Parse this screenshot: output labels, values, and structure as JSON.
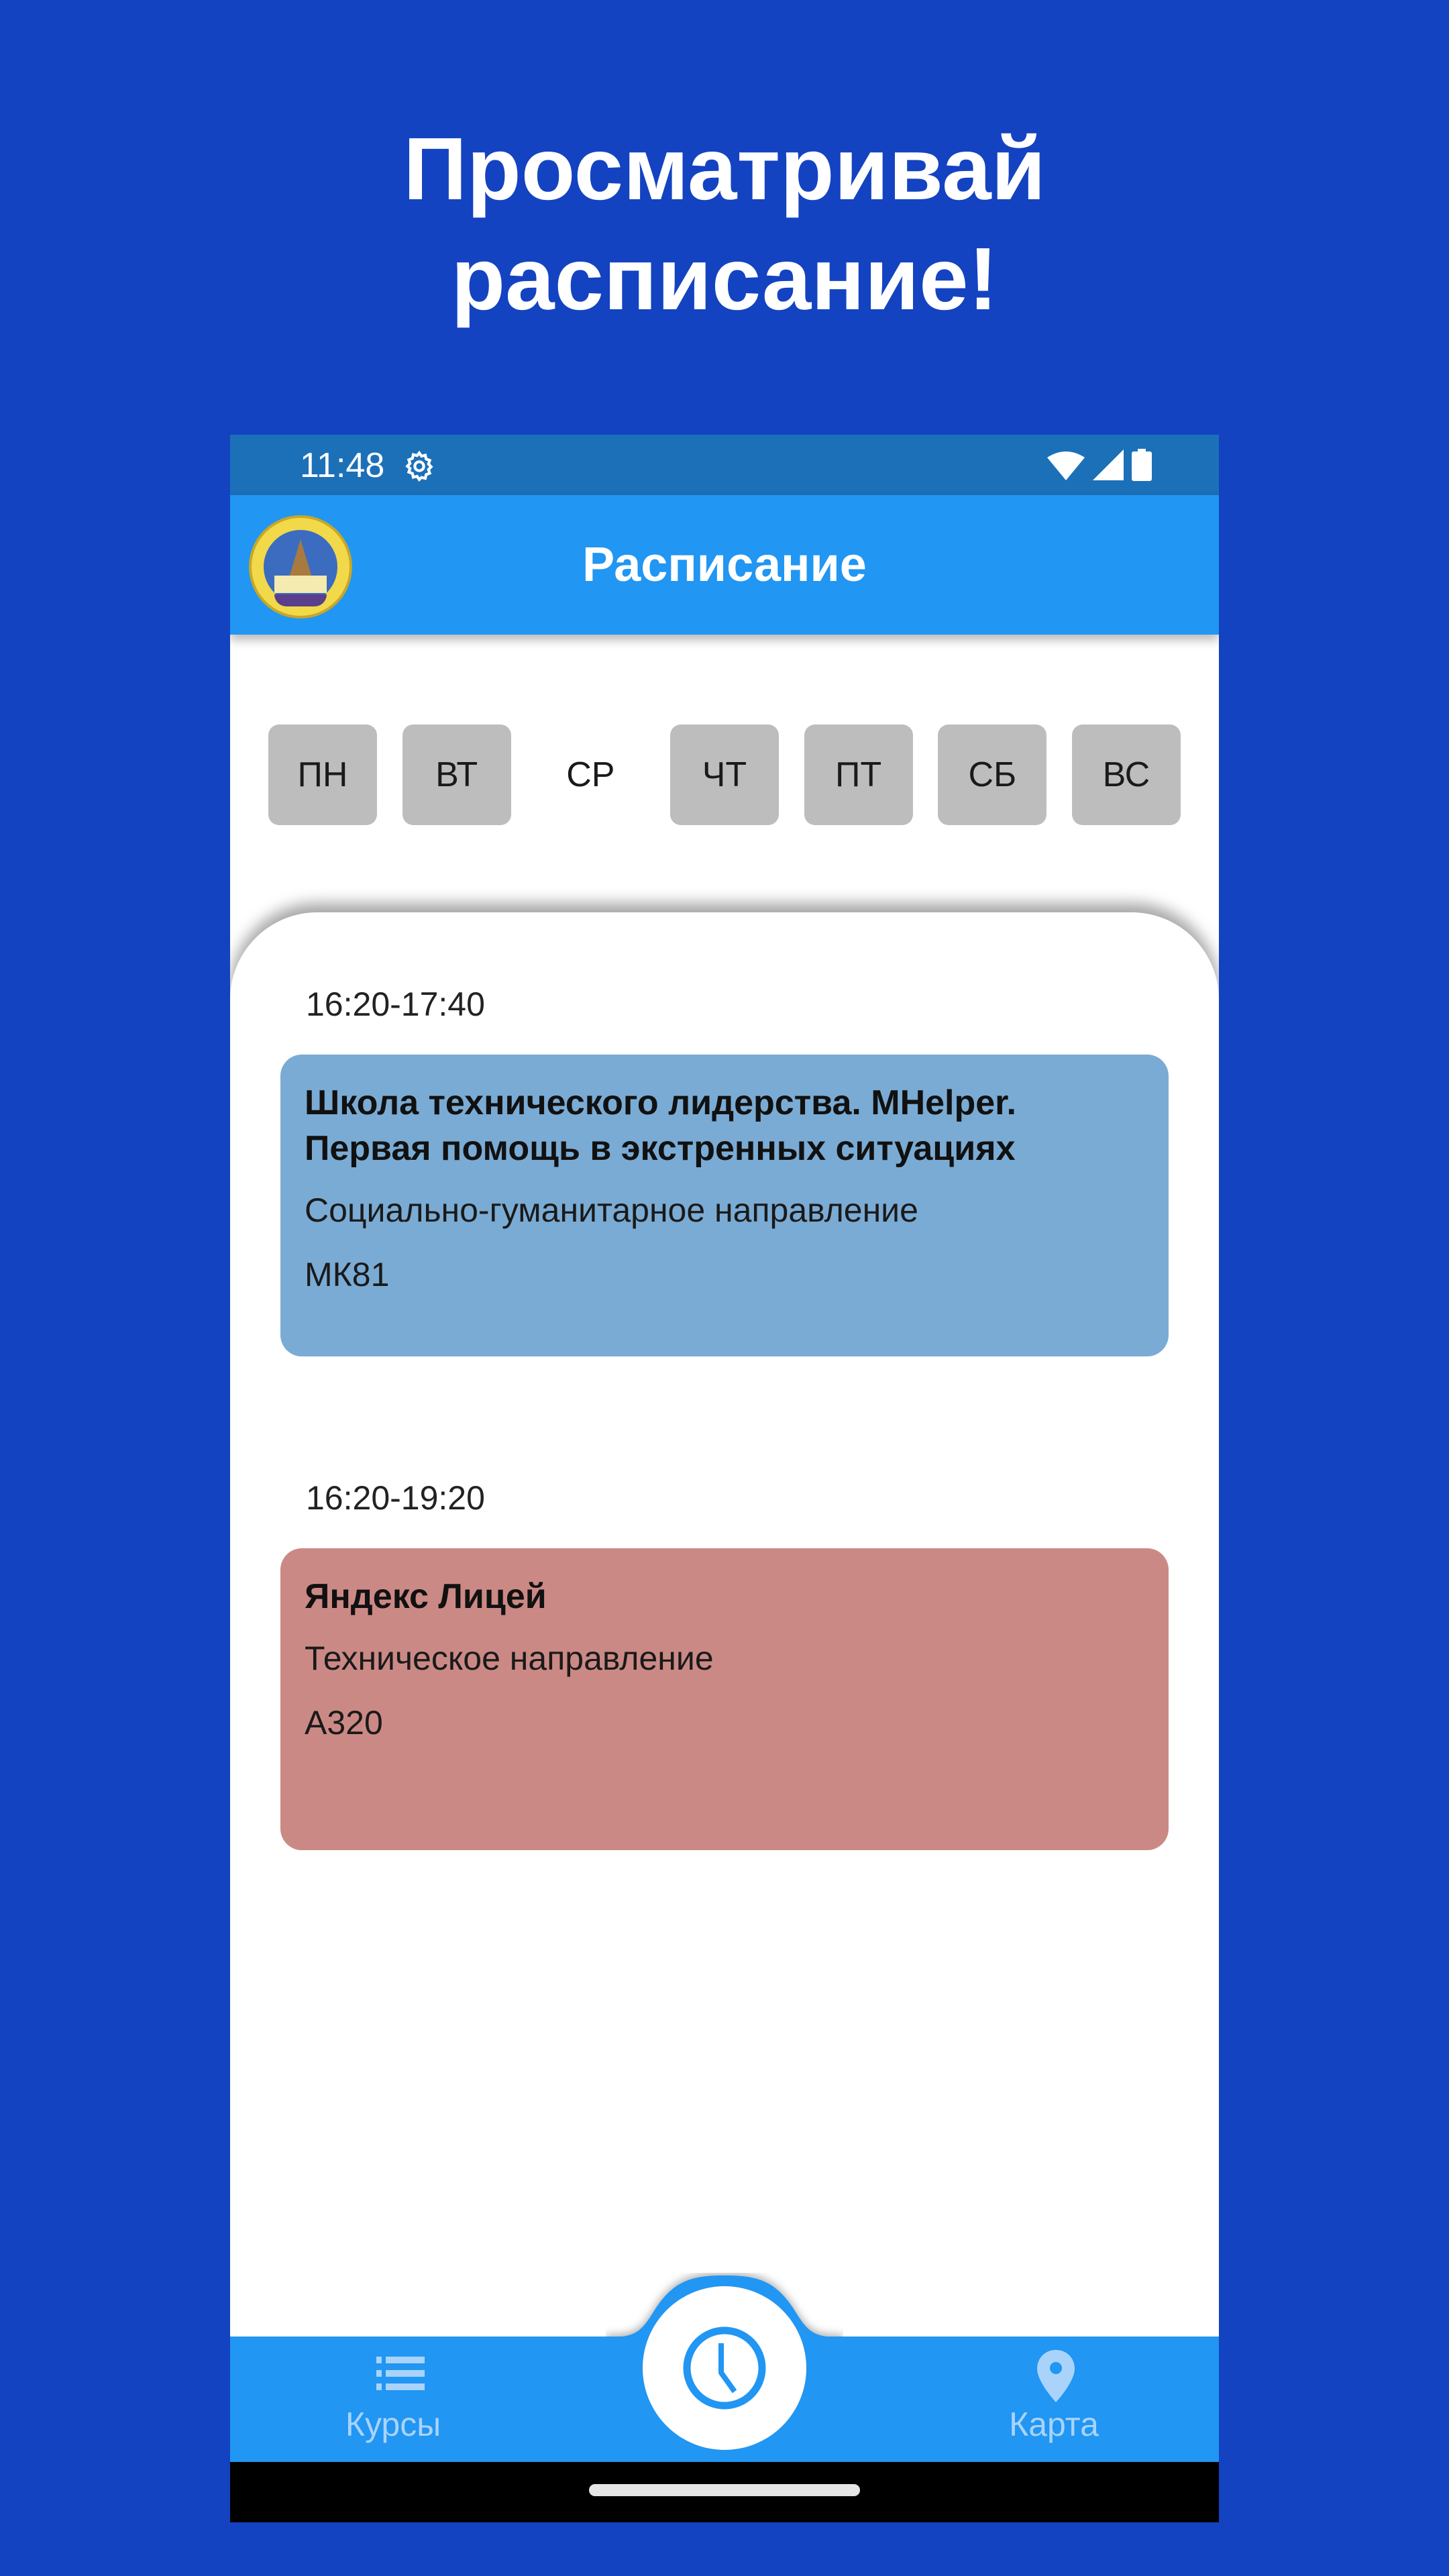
{
  "promo": {
    "headline_line1": "Просматривай",
    "headline_line2": "расписание!"
  },
  "colors": {
    "background": "#1443c1",
    "status_bar": "#1c70b8",
    "app_bar": "#2196f3",
    "day_chip": "#bdbdbd",
    "card_blue": "#7aabd4",
    "card_red": "#cb8985",
    "nav_inactive": "#a9d3fb"
  },
  "status_bar": {
    "time": "11:48",
    "icons": [
      "settings-icon",
      "wifi-icon",
      "signal-icon",
      "battery-icon"
    ]
  },
  "app_bar": {
    "logo": "university-emblem",
    "title": "Расписание"
  },
  "days": [
    {
      "label": "ПН",
      "selected": false
    },
    {
      "label": "ВТ",
      "selected": false
    },
    {
      "label": "СР",
      "selected": true
    },
    {
      "label": "ЧТ",
      "selected": false
    },
    {
      "label": "ПТ",
      "selected": false
    },
    {
      "label": "СБ",
      "selected": false
    },
    {
      "label": "ВС",
      "selected": false
    }
  ],
  "schedule": [
    {
      "time": "16:20-17:40",
      "title": "Школа технического лидерства. MHelper. Первая помощь в экстренных ситуациях",
      "direction": "Социально-гуманитарное направление",
      "room": "МК81",
      "color": "#7aabd4"
    },
    {
      "time": "16:20-19:20",
      "title": "Яндекс Лицей",
      "direction": "Техническое направление",
      "room": "А320",
      "color": "#cb8985"
    }
  ],
  "bottom_nav": {
    "left": {
      "label": "Курсы",
      "icon": "list-icon"
    },
    "center": {
      "icon": "clock-icon",
      "active": true
    },
    "right": {
      "label": "Карта",
      "icon": "map-pin-icon"
    }
  }
}
